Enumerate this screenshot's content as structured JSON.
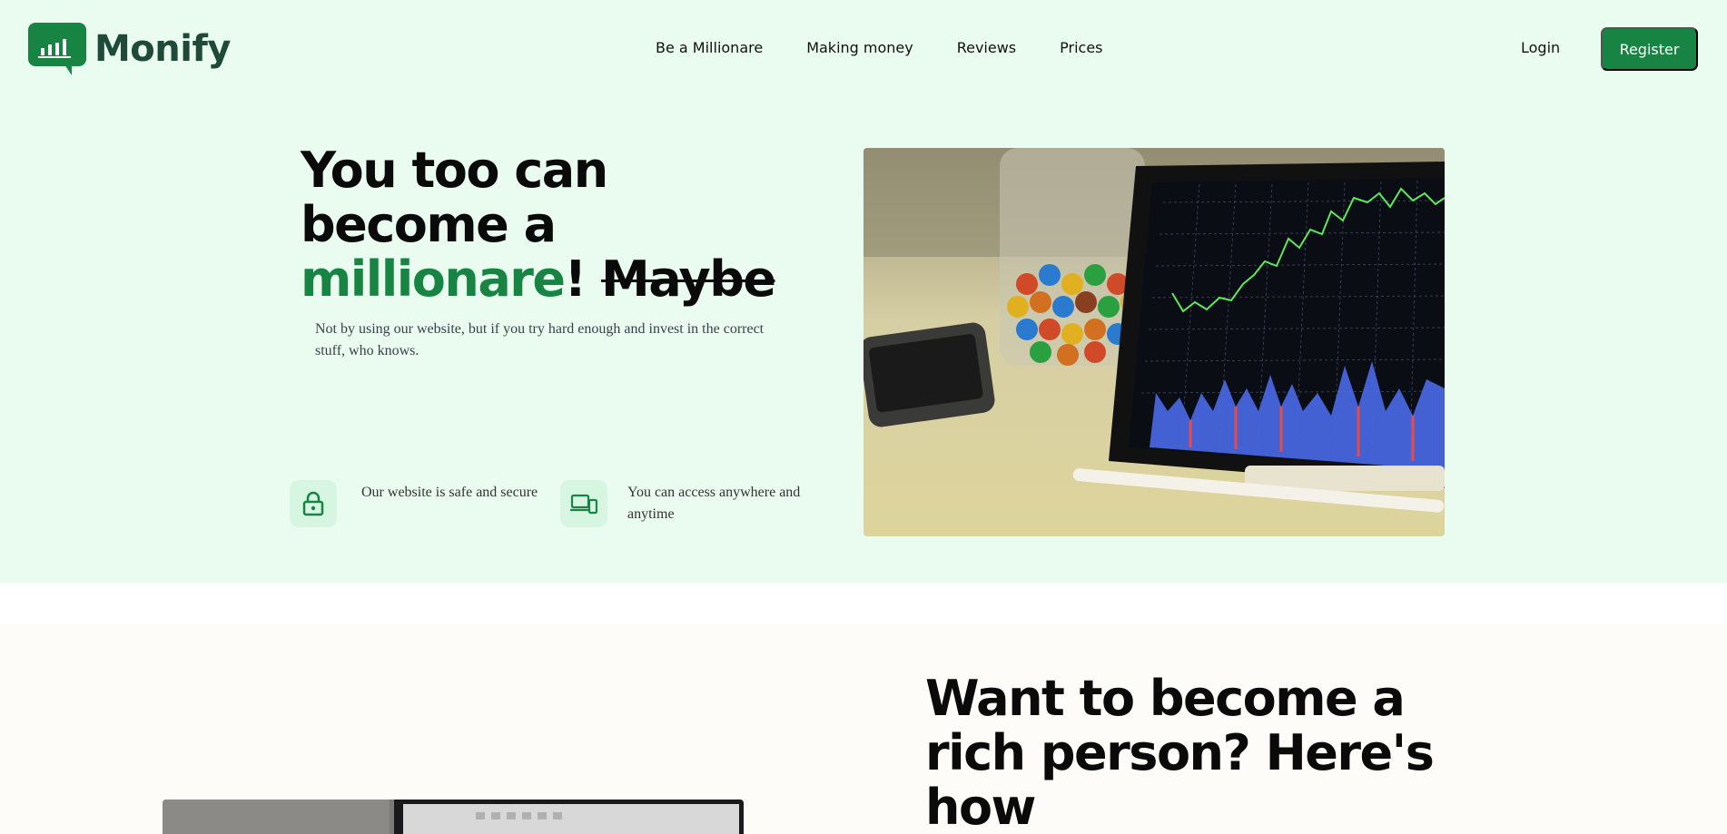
{
  "brand": {
    "name": "Monify",
    "icon": "bar-chart-chat-icon",
    "color": "#178443"
  },
  "nav": {
    "items": [
      {
        "label": "Be a Millionare"
      },
      {
        "label": "Making money"
      },
      {
        "label": "Reviews"
      },
      {
        "label": "Prices"
      }
    ]
  },
  "auth": {
    "login_label": "Login",
    "register_label": "Register"
  },
  "hero": {
    "headline_part1": "You too can become a ",
    "headline_highlight": "millionare",
    "headline_exclaim": "! ",
    "headline_strike": "Maybe",
    "subtext": "Not by using our website, but if you try hard enough and invest in the correct stuff, who knows.",
    "features": [
      {
        "icon": "lock-icon",
        "text": "Our website is safe and secure"
      },
      {
        "icon": "devices-icon",
        "text": "You can access anywhere and anytime"
      }
    ],
    "image": {
      "description_icon": "tablet-stock-chart-photo"
    }
  },
  "section2": {
    "heading": "Want to become a rich person? Here's how",
    "image": {
      "description_icon": "laptop-photo"
    }
  },
  "colors": {
    "hero_bg": "#eafcf0",
    "section2_bg": "#fdfcf8",
    "accent": "#178443",
    "feature_icon_bg": "#d7f6e2"
  }
}
